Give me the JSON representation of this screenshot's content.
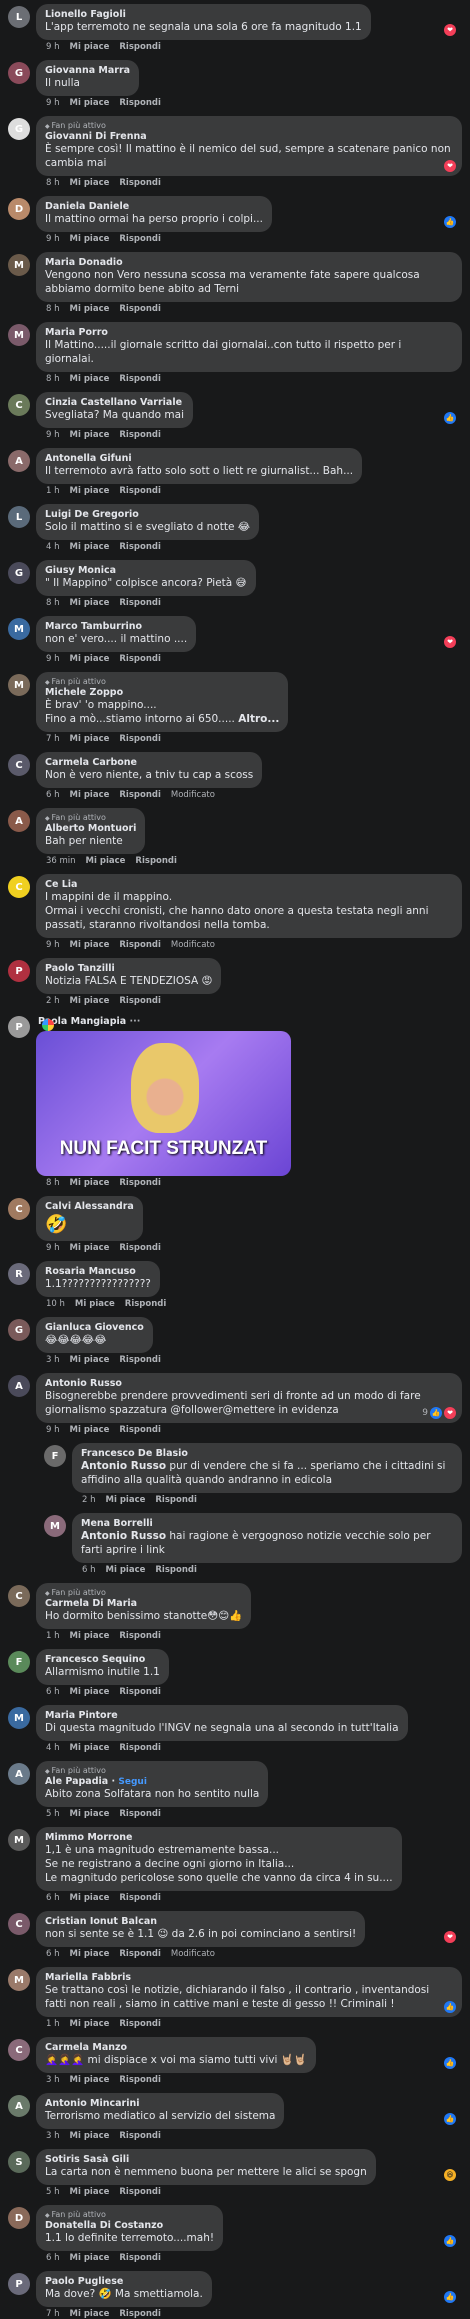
{
  "labels": {
    "like": "Mi piace",
    "reply": "Rispondi",
    "edited": "Modificato",
    "follow": "Segui",
    "fan": "Fan più attivo",
    "more": "Altro..."
  },
  "comments": [
    {
      "name": "Lionello Fagioli",
      "text": "L'app terremoto ne segnala una sola 6 ore fa magnitudo 1.1",
      "time": "9 h",
      "reaction": "heart",
      "color": "#6b6e74"
    },
    {
      "name": "Giovanna Marra",
      "text": "Il nulla",
      "time": "9 h",
      "color": "#8a4a5a"
    },
    {
      "name": "Giovanni Di Frenna",
      "fan": true,
      "text": "È sempre così! Il mattino è il nemico del sud, sempre a scatenare panico non cambia mai",
      "time": "8 h",
      "reaction": "heart",
      "color": "#ddd"
    },
    {
      "name": "Daniela Daniele",
      "text": "Il mattino ormai ha perso proprio i colpi...",
      "time": "9 h",
      "reaction": "like",
      "color": "#b98a6a"
    },
    {
      "name": "Maria Donadio",
      "text": "Vengono non Vero nessuna scossa ma veramente fate sapere qualcosa abbiamo dormito bene abito ad Terni",
      "time": "8 h",
      "color": "#6a5a4a"
    },
    {
      "name": "Maria Porro",
      "text": "Il Mattino.....il giornale scritto dai giornalai..con tutto il rispetto per i giornalai.",
      "time": "8 h",
      "color": "#7a5a6a"
    },
    {
      "name": "Cinzia Castellano Varriale",
      "text": "Svegliata? Ma quando mai",
      "time": "9 h",
      "reaction": "like",
      "color": "#6a7a5a"
    },
    {
      "name": "Antonella Gifuni",
      "text": "Il terremoto avrà fatto solo sott o liett re giurnalist... Bah...",
      "time": "1 h",
      "color": "#8a6a6a"
    },
    {
      "name": "Luigi De Gregorio",
      "text": "Solo il mattino si e svegliato d notte 😂",
      "time": "4 h",
      "color": "#5a6a7a"
    },
    {
      "name": "Giusy Monica",
      "text": "\" Il Mappino\" colpisce ancora? Pietà 😅",
      "time": "8 h",
      "color": "#4a4a5a"
    },
    {
      "name": "Marco Tamburrino",
      "text": "non e' vero.... il mattino ....",
      "time": "9 h",
      "reaction": "heart",
      "color": "#3a6aa0"
    },
    {
      "name": "Michele Zoppo",
      "fan": true,
      "text": "È brav' 'o mappino....\nFino a mò...stiamo intorno ai 650..... Altro...",
      "time": "7 h",
      "color": "#7a6a5a"
    },
    {
      "name": "Carmela Carbone",
      "text": "Non è vero niente, a tniv tu cap a scoss",
      "time": "6 h",
      "edited": true,
      "color": "#5a5a6a"
    },
    {
      "name": "Alberto Montuori",
      "fan": true,
      "text": "Bah per niente",
      "time": "36 min",
      "color": "#8a5a4a"
    },
    {
      "name": "Ce Lia",
      "text": "I mappini de il mappino.\nOrmai i vecchi cronisti, che hanno dato onore a questa testata negli anni passati, staranno rivoltandosi nella tomba.",
      "time": "9 h",
      "edited": true,
      "color": "#f0d020"
    },
    {
      "name": "Paolo Tanzilli",
      "text": "Notizia FALSA E TENDEZIOSA 😡",
      "time": "2 h",
      "color": "#b03040"
    },
    {
      "name": "Paola Mangiapia",
      "gif": "NUN FACIT STRUNZAT",
      "time": "8 h",
      "color": "#9a9a9a"
    },
    {
      "name": "Calvi Alessandra",
      "emoji": "🤣",
      "time": "9 h",
      "color": "#a07a60"
    },
    {
      "name": "Rosaria Mancuso",
      "text": "1.1????????????????",
      "time": "10 h",
      "color": "#6a6a7a"
    },
    {
      "name": "Gianluca Giovenco",
      "text": "😂😂😂😂😂",
      "time": "3 h",
      "color": "#7a5a5a"
    },
    {
      "name": "Antonio Russo",
      "text": "Bisognerebbe prendere provvedimenti seri di fronte ad un modo di fare giornalismo spazzatura @follower@mettere in evidenza",
      "time": "9 h",
      "reaction": "like",
      "count": "9",
      "color": "#4a4a5a"
    },
    {
      "name": "Francesco De Blasio",
      "reply": true,
      "mention": "Antonio Russo",
      "text": "pur di vendere che si fa ... speriamo che i cittadini si affidino alla qualità quando andranno in edicola",
      "time": "2 h",
      "color": "#6a6a6a"
    },
    {
      "name": "Mena Borrelli",
      "reply": true,
      "mention": "Antonio Russo",
      "text": "hai ragione è vergognoso notizie vecchie solo per farti aprire i link",
      "time": "6 h",
      "color": "#8a6a7a"
    },
    {
      "name": "Carmela Di Maria",
      "fan": true,
      "text": "Ho dormito benissimo stanotte😳😊👍",
      "time": "1 h",
      "color": "#7a6a5a"
    },
    {
      "name": "Francesco Sequino",
      "text": "Allarmismo inutile 1.1",
      "time": "6 h",
      "color": "#5a8a5a"
    },
    {
      "name": "Maria Pintore",
      "text": "Di questa magnitudo l'INGV ne segnala una al secondo in tutt'Italia",
      "time": "4 h",
      "color": "#3a6aa0"
    },
    {
      "name": "Ale Papadia",
      "fan": true,
      "follow": true,
      "text": "Abito zona Solfatara non ho sentito nulla",
      "time": "5 h",
      "color": "#6a7a8a"
    },
    {
      "name": "Mimmo Morrone",
      "text": "1,1 è una magnitudo estremamente bassa...\nSe ne registrano a decine ogni giorno in Italia...\nLe magnitudo pericolose sono quelle che vanno da circa 4 in su....",
      "time": "6 h",
      "color": "#5a5a5a"
    },
    {
      "name": "Cristian Ionut Balcan",
      "text": "non si sente se è 1.1 😉 da 2.6 in poi cominciano a sentirsi!",
      "time": "6 h",
      "edited": true,
      "reaction": "heart",
      "color": "#7a5a6a"
    },
    {
      "name": "Mariella Fabbris",
      "text": "Se trattano così le notizie, dichiarando il falso , il contrario , inventandosi fatti non reali , siamo in cattive mani e teste di gesso !! Criminali !",
      "time": "1 h",
      "reaction": "like",
      "color": "#9a7a6a"
    },
    {
      "name": "Carmela Manzo",
      "text": "🤦‍♀️🤦‍♀️🤦‍♀️ mi dispiace x voi ma siamo tutti vivi 🤘🏼🤘🏼",
      "time": "3 h",
      "reaction": "like",
      "color": "#8a6a7a"
    },
    {
      "name": "Antonio Mincarini",
      "text": "Terrorismo mediatico al servizio del sistema",
      "time": "3 h",
      "reaction": "like",
      "color": "#6a7a6a"
    },
    {
      "name": "Sotiris Sasà Gili",
      "text": "La carta non è nemmeno buona per mettere le alici se spogn",
      "time": "5 h",
      "reaction": "haha",
      "color": "#5a6a5a"
    },
    {
      "name": "Donatella Di Costanzo",
      "fan": true,
      "text": "1.1 lo definite terremoto....mah!",
      "time": "6 h",
      "reaction": "like",
      "color": "#8a6a5a"
    },
    {
      "name": "Paolo Pugliese",
      "text": "Ma dove? 🤣 Ma smettiamola.",
      "time": "7 h",
      "reaction": "like",
      "color": "#6a6a7a"
    }
  ]
}
